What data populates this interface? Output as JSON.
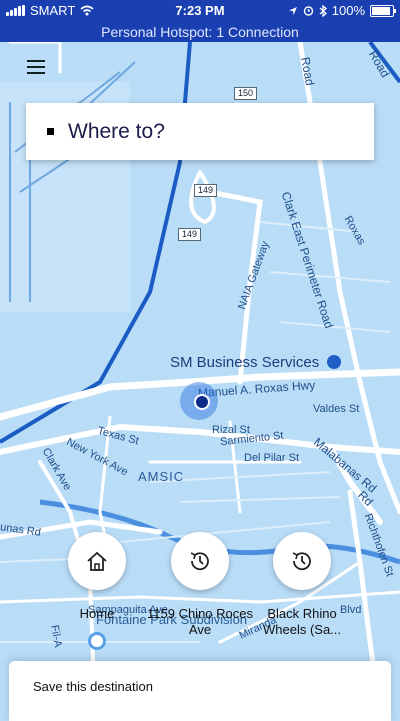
{
  "status_bar": {
    "carrier": "SMART",
    "time": "7:23 PM",
    "battery": "100%",
    "battery_level": 1.0,
    "icons": [
      "signal-icon",
      "wifi-icon",
      "location-arrow-icon",
      "alarm-icon",
      "bluetooth-icon",
      "battery-icon"
    ]
  },
  "hotspot_banner": "Personal Hotspot: 1 Connection",
  "menu_icon": "hamburger-menu-icon",
  "search": {
    "label": "Where to?"
  },
  "map": {
    "route_shields": [
      "150",
      "149",
      "149"
    ],
    "streets": [
      "Clark East Perimeter Road",
      "NAIA Gateway",
      "Manuel A. Roxas Hwy",
      "Valdes St",
      "Rizal St",
      "Sarmiento St",
      "Del Pilar St",
      "Texas St",
      "New York Ave",
      "Clark Ave",
      "Malabanas Rd",
      "Richthofen St",
      "Sampaguita Ave",
      "Roxas",
      "Road",
      "Road",
      "Rd",
      "unas Rd",
      "Fil-A"
    ],
    "poi": "SM Business Services",
    "district": "AMSIC",
    "park": "Fontaine Park Subdivision",
    "extra": [
      "Blvd",
      "Miranda"
    ]
  },
  "shortcuts": [
    {
      "label": "Home",
      "icon": "home-icon"
    },
    {
      "label": "1159 Chino Roces Ave",
      "icon": "history-clock-icon"
    },
    {
      "label": "Black Rhino Wheels (Sa...",
      "icon": "history-clock-icon"
    }
  ],
  "bottom_sheet": {
    "title": "Save this destination"
  },
  "colors": {
    "status_bar": "#1a3fb0",
    "map_bg": "#b9dcf7",
    "road": "#ffffff",
    "highway": "#1b5bc4"
  }
}
